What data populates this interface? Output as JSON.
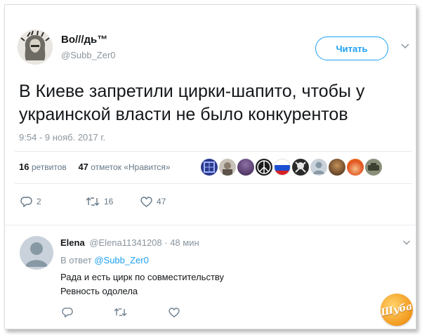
{
  "tweet": {
    "display_name": "Во///дь™",
    "handle": "@Subb_Zer0",
    "follow_label": "Читать",
    "text_line1": "В Киеве запретили цирки-шапито, чтобы у",
    "text_line2": "украинской власти не было конкурентов",
    "timestamp": "9:54 - 9 нояб. 2017 г.",
    "retweets_count": "16",
    "retweets_label": "ретвитов",
    "likes_count": "47",
    "likes_label": "отметок «Нравится»",
    "actions": {
      "replies": "2",
      "retweets": "16",
      "likes": "47"
    }
  },
  "reply": {
    "name": "Elena",
    "handle": "@Elena11341208",
    "time": "· 48 мин",
    "in_reply_prefix": "В ответ",
    "in_reply_handle": "@Subb_Zer0",
    "text_line1": "Рада и есть цирк по совместительству",
    "text_line2": "Ревность одолела"
  },
  "watermark": "Шуба",
  "colors": {
    "accent": "#1da1f2",
    "muted": "#8a959e",
    "text": "#14171a"
  },
  "icons": [
    "reply-icon",
    "retweet-icon",
    "like-icon",
    "chevron-down-icon",
    "default-avatar-icon"
  ]
}
